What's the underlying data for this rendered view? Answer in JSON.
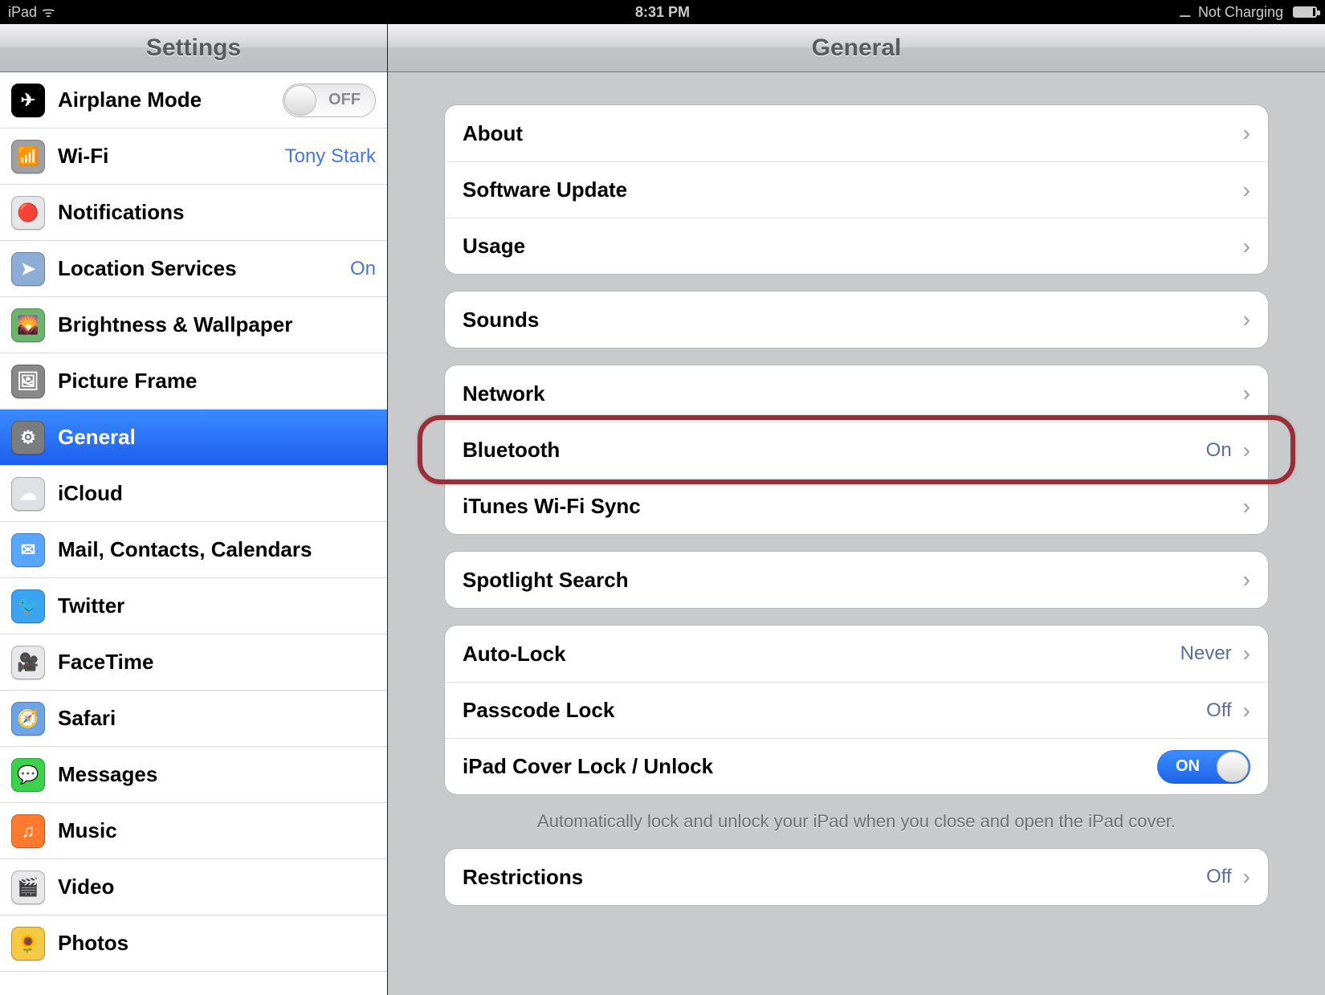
{
  "statusbar": {
    "device": "iPad",
    "time": "8:31 PM",
    "power": "Not Charging"
  },
  "sidebar": {
    "title": "Settings",
    "airplane": {
      "label": "Airplane Mode",
      "toggle": "OFF"
    },
    "items": [
      {
        "label": "Wi-Fi",
        "value": "Tony Stark",
        "icon_bg": "#9ea0a3",
        "glyph": "📶"
      },
      {
        "label": "Notifications",
        "value": "",
        "icon_bg": "#e5e6e8",
        "glyph": "🔴"
      },
      {
        "label": "Location Services",
        "value": "On",
        "icon_bg": "#8eadd4",
        "glyph": "➤"
      },
      {
        "label": "Brightness & Wallpaper",
        "value": "",
        "icon_bg": "#6db56d",
        "glyph": "🌄"
      },
      {
        "label": "Picture Frame",
        "value": "",
        "icon_bg": "#888",
        "glyph": "🖼"
      },
      {
        "label": "General",
        "value": "",
        "icon_bg": "#7a7c80",
        "glyph": "⚙",
        "selected": true
      },
      {
        "label": "iCloud",
        "value": "",
        "icon_bg": "#dfe1e4",
        "glyph": "☁"
      },
      {
        "label": "Mail, Contacts, Calendars",
        "value": "",
        "icon_bg": "#59a6ff",
        "glyph": "✉"
      },
      {
        "label": "Twitter",
        "value": "",
        "icon_bg": "#3aa4f0",
        "glyph": "🐦"
      },
      {
        "label": "FaceTime",
        "value": "",
        "icon_bg": "#e8e8ea",
        "glyph": "🎥"
      },
      {
        "label": "Safari",
        "value": "",
        "icon_bg": "#6ea4e6",
        "glyph": "🧭"
      },
      {
        "label": "Messages",
        "value": "",
        "icon_bg": "#3ad24a",
        "glyph": "💬"
      },
      {
        "label": "Music",
        "value": "",
        "icon_bg": "#ff7a2f",
        "glyph": "♫"
      },
      {
        "label": "Video",
        "value": "",
        "icon_bg": "#e8e8ea",
        "glyph": "🎬"
      },
      {
        "label": "Photos",
        "value": "",
        "icon_bg": "#f6c945",
        "glyph": "🌻"
      }
    ]
  },
  "detail": {
    "title": "General",
    "groups": [
      [
        {
          "label": "About",
          "value": ""
        },
        {
          "label": "Software Update",
          "value": ""
        },
        {
          "label": "Usage",
          "value": ""
        }
      ],
      [
        {
          "label": "Sounds",
          "value": ""
        }
      ],
      [
        {
          "label": "Network",
          "value": ""
        },
        {
          "label": "Bluetooth",
          "value": "On",
          "highlight": true
        },
        {
          "label": "iTunes Wi-Fi Sync",
          "value": ""
        }
      ],
      [
        {
          "label": "Spotlight Search",
          "value": ""
        }
      ],
      [
        {
          "label": "Auto-Lock",
          "value": "Never"
        },
        {
          "label": "Passcode Lock",
          "value": "Off"
        },
        {
          "label": "iPad Cover Lock / Unlock",
          "toggle": "ON"
        }
      ],
      [
        {
          "label": "Restrictions",
          "value": "Off"
        }
      ]
    ],
    "footnote_after_group": 4,
    "footnote": "Automatically lock and unlock your iPad when you close and open the iPad cover."
  }
}
